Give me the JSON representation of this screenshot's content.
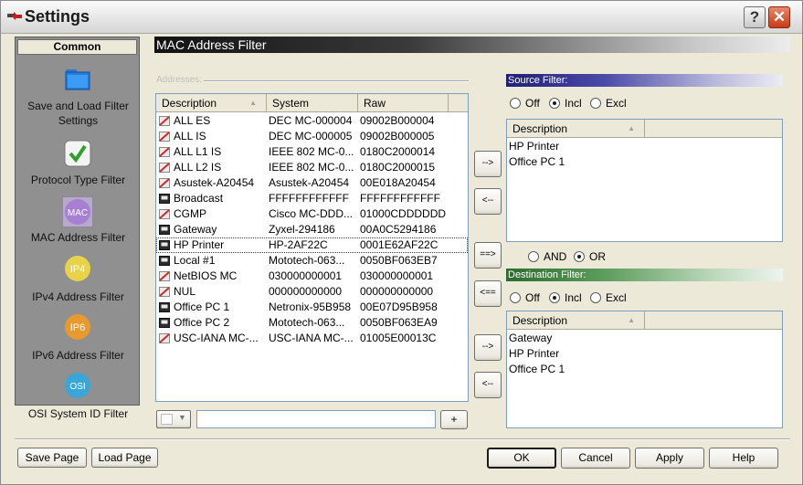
{
  "window": {
    "title": "Settings",
    "help_label": "?",
    "close_label": "✕"
  },
  "nav": {
    "header": "Common",
    "items": [
      {
        "label": "Save and Load Filter Settings",
        "icon": "folder-icon"
      },
      {
        "label": "Protocol Type Filter",
        "icon": "checkmark-icon"
      },
      {
        "label": "MAC Address Filter",
        "icon": "mac-icon",
        "icon_text": "MAC"
      },
      {
        "label": "IPv4 Address Filter",
        "icon": "ipv4-icon",
        "icon_text": "IP4"
      },
      {
        "label": "IPv6 Address Filter",
        "icon": "ipv6-icon",
        "icon_text": "IP6"
      },
      {
        "label": "OSI System ID Filter",
        "icon": "osi-icon",
        "icon_text": "OSI"
      }
    ]
  },
  "main": {
    "title": "MAC Address Filter",
    "addresses_label": "Addresses:",
    "columns": [
      "Description",
      "System",
      "Raw"
    ],
    "rows": [
      {
        "description": "ALL ES",
        "system": "DEC MC-000004",
        "raw": "09002B000004",
        "icon": "red"
      },
      {
        "description": "ALL IS",
        "system": "DEC MC-000005",
        "raw": "09002B000005",
        "icon": "red"
      },
      {
        "description": "ALL L1 IS",
        "system": "IEEE 802 MC-0...",
        "raw": "0180C2000014",
        "icon": "red"
      },
      {
        "description": "ALL L2 IS",
        "system": "IEEE 802 MC-0...",
        "raw": "0180C2000015",
        "icon": "red"
      },
      {
        "description": "Asustek-A20454",
        "system": "Asustek-A20454",
        "raw": "00E018A20454",
        "icon": "red"
      },
      {
        "description": "Broadcast",
        "system": "FFFFFFFFFFFF",
        "raw": "FFFFFFFFFFFF",
        "icon": "dark"
      },
      {
        "description": "CGMP",
        "system": "Cisco MC-DDD...",
        "raw": "01000CDDDDDD",
        "icon": "red"
      },
      {
        "description": "Gateway",
        "system": "Zyxel-294186",
        "raw": "00A0C5294186",
        "icon": "dark"
      },
      {
        "description": "HP Printer",
        "system": "HP-2AF22C",
        "raw": "0001E62AF22C",
        "icon": "dark"
      },
      {
        "description": "Local #1",
        "system": "Mototech-063...",
        "raw": "0050BF063EB7",
        "icon": "dark"
      },
      {
        "description": "NetBIOS MC",
        "system": "030000000001",
        "raw": "030000000001",
        "icon": "red"
      },
      {
        "description": "NUL",
        "system": "000000000000",
        "raw": "000000000000",
        "icon": "red"
      },
      {
        "description": "Office PC 1",
        "system": "Netronix-95B958",
        "raw": "00E07D95B958",
        "icon": "dark"
      },
      {
        "description": "Office PC 2",
        "system": "Mototech-063...",
        "raw": "0050BF063EA9",
        "icon": "dark"
      },
      {
        "description": "USC-IANA MC-...",
        "system": "USC-IANA MC-...",
        "raw": "01005E00013C",
        "icon": "red"
      }
    ],
    "add_button": "+",
    "search_value": ""
  },
  "transfer": {
    "add_source": "-->",
    "remove_source": "<--",
    "add_both": "==>",
    "remove_both": "<==",
    "add_dest": "-->",
    "remove_dest": "<--"
  },
  "source_filter": {
    "title": "Source Filter:",
    "options": [
      "Off",
      "Incl",
      "Excl"
    ],
    "selected": "Incl",
    "column": "Description",
    "items": [
      "HP Printer",
      "Office PC 1"
    ]
  },
  "logic": {
    "options": [
      "AND",
      "OR"
    ],
    "selected": "OR"
  },
  "dest_filter": {
    "title": "Destination Filter:",
    "options": [
      "Off",
      "Incl",
      "Excl"
    ],
    "selected": "Incl",
    "column": "Description",
    "items": [
      "Gateway",
      "HP Printer",
      "Office PC 1"
    ]
  },
  "footer": {
    "save_page": "Save Page",
    "load_page": "Load Page",
    "ok": "OK",
    "cancel": "Cancel",
    "apply": "Apply",
    "help": "Help"
  },
  "colors": {
    "source_accent": "#3b3b9c",
    "dest_accent": "#4a8a4a",
    "red_icon": "#c03030"
  }
}
